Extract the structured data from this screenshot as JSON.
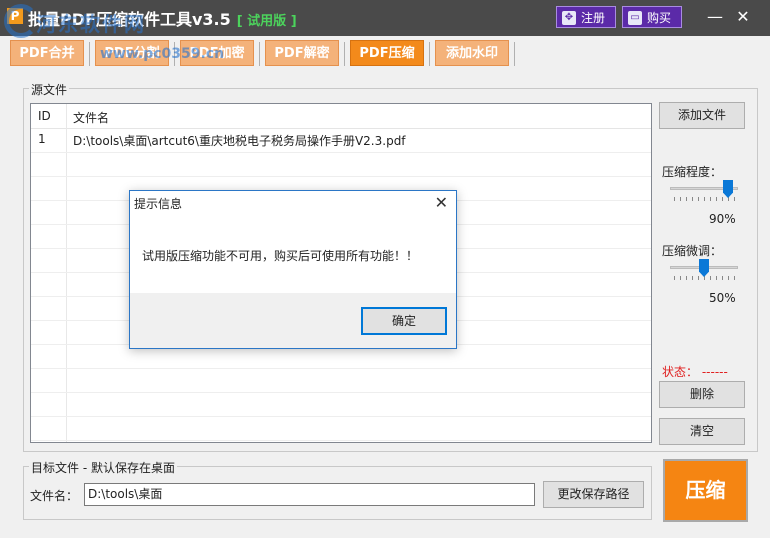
{
  "window": {
    "logo_letter": "P",
    "title": "批量PDF压缩软件工具v3.5",
    "trial_tag": "[ 试用版 ]",
    "register_label": "注册",
    "buy_label": "购买",
    "minimize": "—",
    "close": "✕"
  },
  "tabs": [
    {
      "label": "PDF合并"
    },
    {
      "label": "PDF分割"
    },
    {
      "label": "PDF加密"
    },
    {
      "label": "PDF解密"
    },
    {
      "label": "PDF压缩"
    },
    {
      "label": "添加水印"
    }
  ],
  "source": {
    "group_label": "源文件",
    "columns": [
      "ID",
      "文件名"
    ],
    "rows": [
      {
        "id": "1",
        "file": "D:\\tools\\桌面\\artcut6\\重庆地税电子税务局操作手册V2.3.pdf"
      }
    ]
  },
  "side": {
    "add_file": "添加文件",
    "compress_level_label": "压缩程度：",
    "compress_level_value": "90%",
    "compress_level_fraction": 0.9,
    "fine_tune_label": "压缩微调：",
    "fine_tune_value": "50%",
    "fine_tune_fraction": 0.5,
    "status_label": "状态：",
    "status_value": "------",
    "delete": "删除",
    "clear": "清空",
    "compress": "压缩"
  },
  "dest": {
    "group_label": "目标文件 - 默认保存在桌面",
    "file_name_label": "文件名：",
    "path_value": "D:\\tools\\桌面",
    "change_path": "更改保存路径"
  },
  "dialog": {
    "title": "提示信息",
    "close": "✕",
    "message": "试用版压缩功能不可用，购买后可使用所有功能！！",
    "ok": "确定"
  },
  "watermark": {
    "line1": "河东软件网",
    "line2": "www.pc0359.cn"
  },
  "colors": {
    "titlebar": "#4a4a4a",
    "tab": "#f4b27a",
    "tab_active": "#f38a1b",
    "compress_button": "#f58512",
    "register_buttons": "#5b2aa8",
    "status": "#e02020"
  }
}
